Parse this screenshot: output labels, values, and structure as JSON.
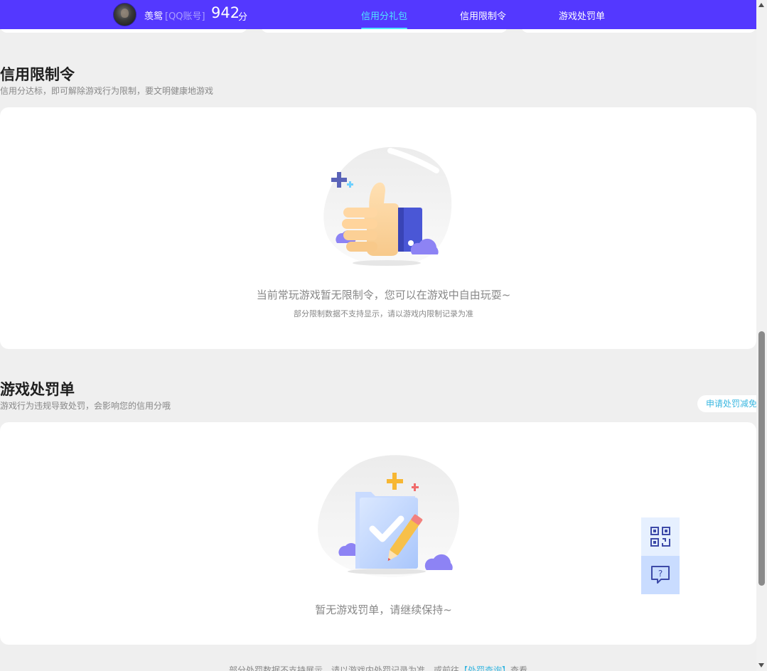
{
  "nav": {
    "user_name": "羡鸳",
    "account_tag": "[QQ账号]",
    "score": "942",
    "score_unit": "分",
    "tabs": [
      {
        "label": "信用分礼包",
        "active": true
      },
      {
        "label": "信用限制令",
        "active": false
      },
      {
        "label": "游戏处罚单",
        "active": false
      }
    ],
    "colors": {
      "background": "#5438ff",
      "active_tab": "#4fe4ff"
    }
  },
  "restriction": {
    "title": "信用限制令",
    "subtitle": "信用分达标，即可解除游戏行为限制，要文明健康地游戏",
    "empty_message": "当前常玩游戏暂无限制令，您可以在游戏中自由玩耍~",
    "empty_note": "部分限制数据不支持显示，请以游戏内限制记录为准",
    "illustration_icon": "thumbs-up-icon"
  },
  "penalty": {
    "title": "游戏处罚单",
    "subtitle": "游戏行为违规导致处罚，会影响您的信用分哦",
    "appeal_button": "申请处罚减免",
    "empty_message": "暂无游戏罚单，请继续保持~",
    "illustration_icon": "checklist-pencil-icon",
    "footer_before": "部分处罚数据不支持展示，请以游戏内处罚记录为准，或前往",
    "footer_link": "【处罚查询】",
    "footer_after": "查看"
  },
  "floating_tools": [
    {
      "icon": "qr-code-icon"
    },
    {
      "icon": "feedback-question-icon"
    }
  ]
}
